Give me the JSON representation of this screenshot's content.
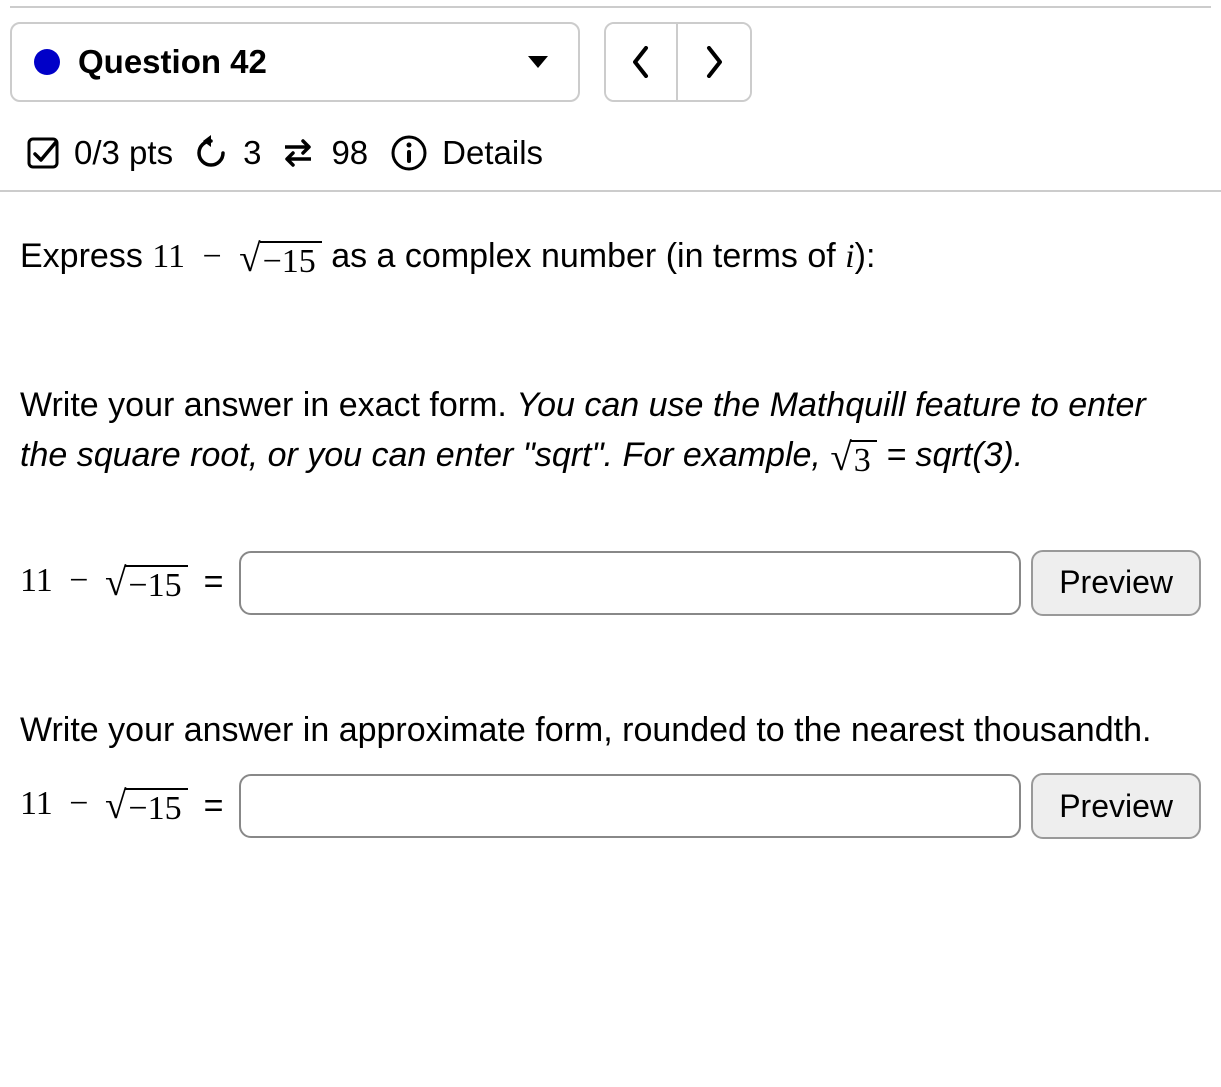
{
  "header": {
    "question_label": "Question 42"
  },
  "meta": {
    "score": "0/3 pts",
    "retries": "3",
    "attempts_left": "98",
    "details_label": "Details"
  },
  "prompt": {
    "prefix": "Express ",
    "expr_a": "11",
    "expr_op": "−",
    "sqrt_inner": "−15",
    "suffix": " as a complex number (in terms of ",
    "ivar": "i",
    "suffix2": "):"
  },
  "instructions": {
    "line1": "Write your answer in exact form. ",
    "italic": "You can use the Mathquill feature to enter the square root, or you can enter \"sqrt\". For example, ",
    "example_sqrt_inner": "3",
    "italic_tail": " = sqrt(3)."
  },
  "answer1": {
    "expr_a": "11",
    "expr_op": "−",
    "sqrt_inner": "−15",
    "value": "",
    "preview_label": "Preview"
  },
  "section2_text": "Write your answer in approximate form, rounded to the nearest thousandth.",
  "answer2": {
    "expr_a": "11",
    "expr_op": "−",
    "sqrt_inner": "−15",
    "value": "",
    "preview_label": "Preview"
  }
}
